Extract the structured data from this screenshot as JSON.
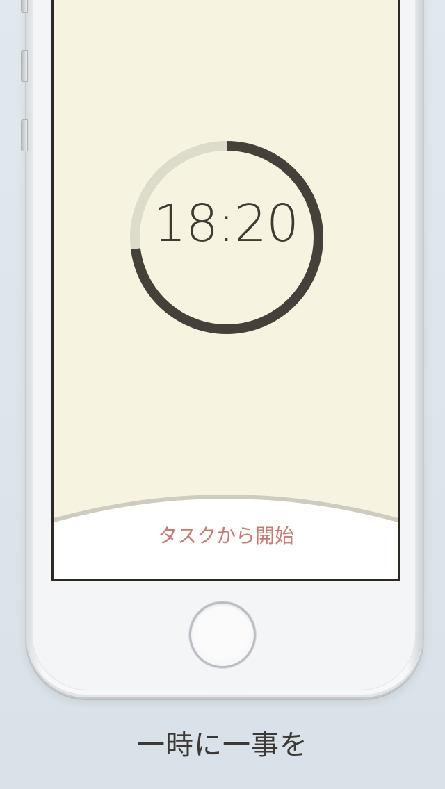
{
  "timer": {
    "time": "18:20",
    "progress_fraction": 0.73,
    "track_color": "#dddbc9",
    "progress_color": "#45413a"
  },
  "screen": {
    "background_color": "#f6f3e1",
    "start_button_label": "タスクから開始",
    "start_button_color": "#c47b73"
  },
  "tagline": "一時に一事を"
}
